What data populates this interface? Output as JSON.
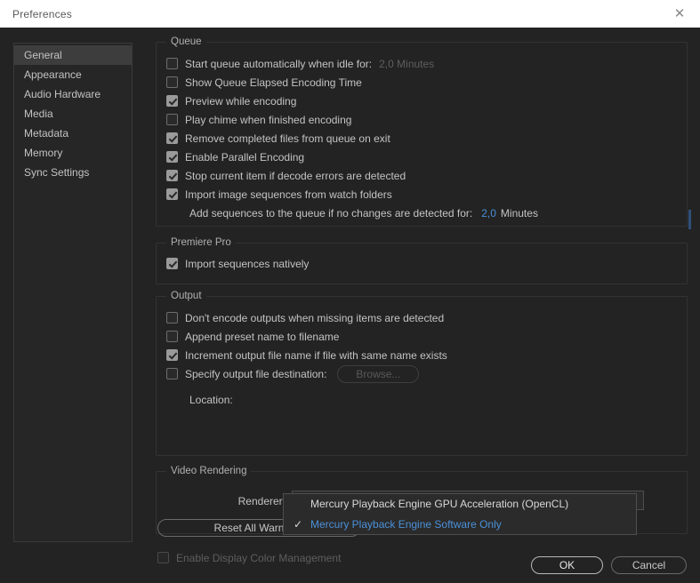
{
  "titlebar": {
    "title": "Preferences",
    "close_icon": "close-icon",
    "close_glyph": "✕"
  },
  "sidebar": {
    "items": [
      {
        "label": "General",
        "selected": true
      },
      {
        "label": "Appearance",
        "selected": false
      },
      {
        "label": "Audio Hardware",
        "selected": false
      },
      {
        "label": "Media",
        "selected": false
      },
      {
        "label": "Metadata",
        "selected": false
      },
      {
        "label": "Memory",
        "selected": false
      },
      {
        "label": "Sync Settings",
        "selected": false
      }
    ]
  },
  "queue": {
    "legend": "Queue",
    "items": [
      {
        "label": "Start queue automatically when idle for:",
        "checked": false,
        "disabled": false
      },
      {
        "label": "Show Queue Elapsed Encoding Time",
        "checked": false,
        "disabled": false
      },
      {
        "label": "Preview while encoding",
        "checked": true,
        "disabled": false
      },
      {
        "label": "Play chime when finished encoding",
        "checked": false,
        "disabled": false
      },
      {
        "label": "Remove completed files from queue on exit",
        "checked": true,
        "disabled": false
      },
      {
        "label": "Enable Parallel Encoding",
        "checked": true,
        "disabled": false
      },
      {
        "label": "Stop current item if decode errors are detected",
        "checked": true,
        "disabled": false
      },
      {
        "label": "Import image sequences from watch folders",
        "checked": true,
        "disabled": false
      }
    ],
    "idle_value": "2,0",
    "idle_unit": "Minutes",
    "sub_label": "Add sequences to the queue if no changes are detected for:",
    "sub_value": "2,0",
    "sub_unit": "Minutes"
  },
  "premiere": {
    "legend": "Premiere Pro",
    "items": [
      {
        "label": "Import sequences natively",
        "checked": true,
        "disabled": false
      }
    ]
  },
  "output": {
    "legend": "Output",
    "items": [
      {
        "label": "Don't encode outputs when missing items are detected",
        "checked": false,
        "disabled": false
      },
      {
        "label": "Append preset name to filename",
        "checked": false,
        "disabled": false
      },
      {
        "label": "Increment output file name if file with same name exists",
        "checked": true,
        "disabled": false
      },
      {
        "label": "Specify output file destination:",
        "checked": false,
        "disabled": false
      }
    ],
    "browse_label": "Browse...",
    "location_label": "Location:",
    "location_value": ""
  },
  "video_rendering": {
    "legend": "Video Rendering",
    "renderer_label": "Renderer:",
    "renderer_value": "Mercury Playback Engine Software Only",
    "arrow_icon": "chevron-down-icon",
    "arrow_glyph": "⌄",
    "options": [
      {
        "label": "Mercury Playback Engine GPU Acceleration (OpenCL)",
        "selected": false
      },
      {
        "label": "Mercury Playback Engine Software Only",
        "selected": true
      }
    ],
    "check_glyph": "✓"
  },
  "color_management": {
    "label": "Enable Display Color Management",
    "checked": false,
    "disabled": true
  },
  "footer": {
    "reset_label": "Reset All Warnings",
    "ok_label": "OK",
    "cancel_label": "Cancel"
  },
  "colors": {
    "accent_blue": "#4a90d9",
    "dialog_bg": "#232323",
    "titlebar_bg": "#ffffff",
    "selected_item_bg": "#3d3d3d"
  }
}
